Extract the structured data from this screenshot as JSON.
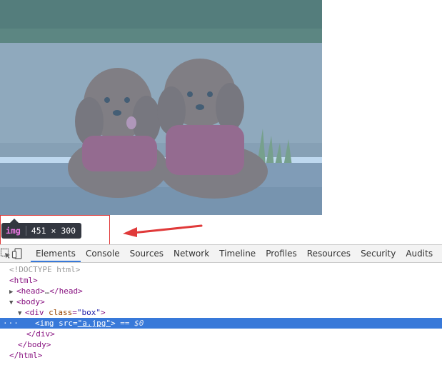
{
  "image": {
    "subject": "two brown poodles in red sweaters",
    "highlight_color": "#6fa8dc"
  },
  "tooltip": {
    "tag": "img",
    "size": "451 × 300"
  },
  "annotation": {
    "box_color": "#e03a3a",
    "arrow_color": "#e03a3a"
  },
  "devtools": {
    "toolbar": {
      "inspect_icon": "inspect-element-icon",
      "device_icon": "device-mode-icon",
      "tabs": [
        "Elements",
        "Console",
        "Sources",
        "Network",
        "Timeline",
        "Profiles",
        "Resources",
        "Security",
        "Audits",
        "A"
      ],
      "active_tab": "Elements",
      "accent": "#3879d9"
    },
    "dom": {
      "doctype": "<!DOCTYPE html>",
      "html_open": "<html>",
      "head": {
        "open": "<head>",
        "ellipsis": "…",
        "close": "</head>"
      },
      "body_open": "<body>",
      "div": {
        "open": "<div",
        "attr": "class",
        "eq": "=",
        "value": "\"box\"",
        "close": ">"
      },
      "img": {
        "open": "<img",
        "attr": "src",
        "eq": "=",
        "value": "\"a.jpg\"",
        "close": ">",
        "marker": "== $0",
        "dots": "···"
      },
      "div_close": "</div>",
      "body_close": "</body>",
      "html_close": "</html>"
    }
  }
}
